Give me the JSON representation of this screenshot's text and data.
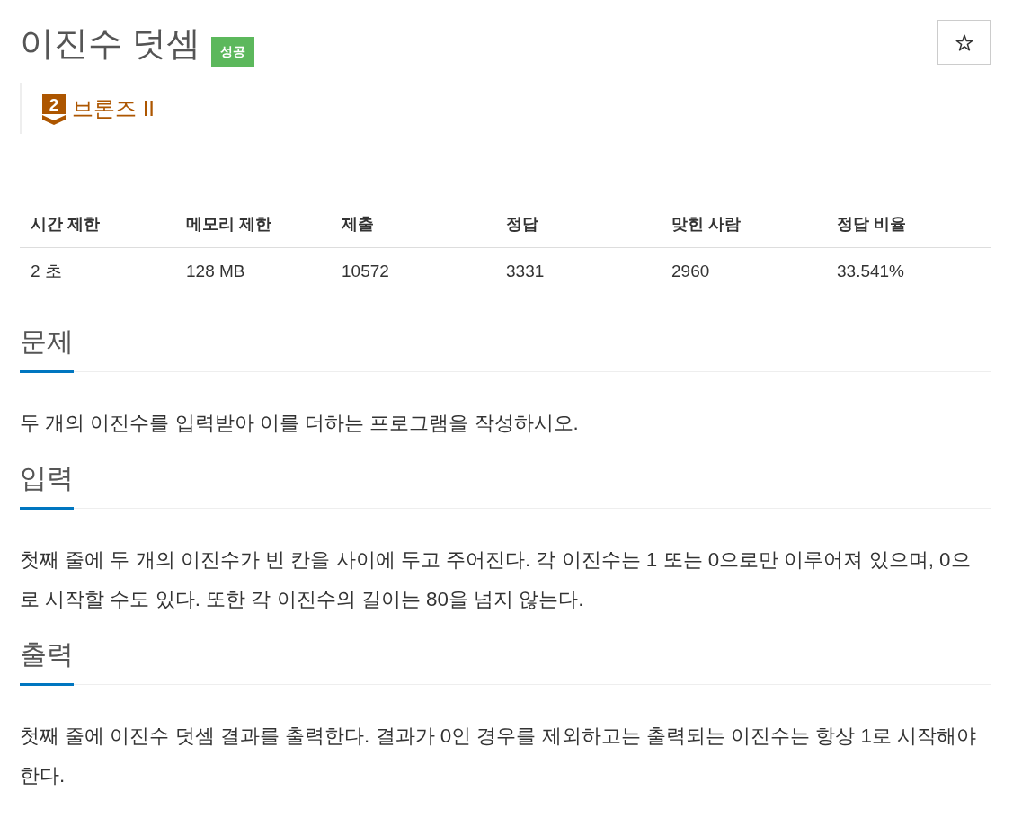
{
  "problem": {
    "title": "이진수 덧셈",
    "result_badge": "성공",
    "starred": false
  },
  "tier": {
    "level": "2",
    "name": "브론즈 II"
  },
  "info_table": {
    "columns": [
      "시간 제한",
      "메모리 제한",
      "제출",
      "정답",
      "맞힌 사람",
      "정답 비율"
    ],
    "rows": [
      [
        "2 초",
        "128 MB",
        "10572",
        "3331",
        "2960",
        "33.541%"
      ]
    ]
  },
  "sections": [
    {
      "heading": "문제",
      "text": "두 개의 이진수를 입력받아 이를 더하는 프로그램을 작성하시오."
    },
    {
      "heading": "입력",
      "text": "첫째 줄에 두 개의 이진수가 빈 칸을 사이에 두고 주어진다. 각 이진수는 1 또는 0으로만 이루어져 있으며, 0으로 시작할 수도 있다. 또한 각 이진수의 길이는 80을 넘지 않는다."
    },
    {
      "heading": "출력",
      "text": "첫째 줄에 이진수 덧셈 결과를 출력한다. 결과가 0인 경우를 제외하고는 출력되는 이진수는 항상 1로 시작해야 한다."
    }
  ]
}
